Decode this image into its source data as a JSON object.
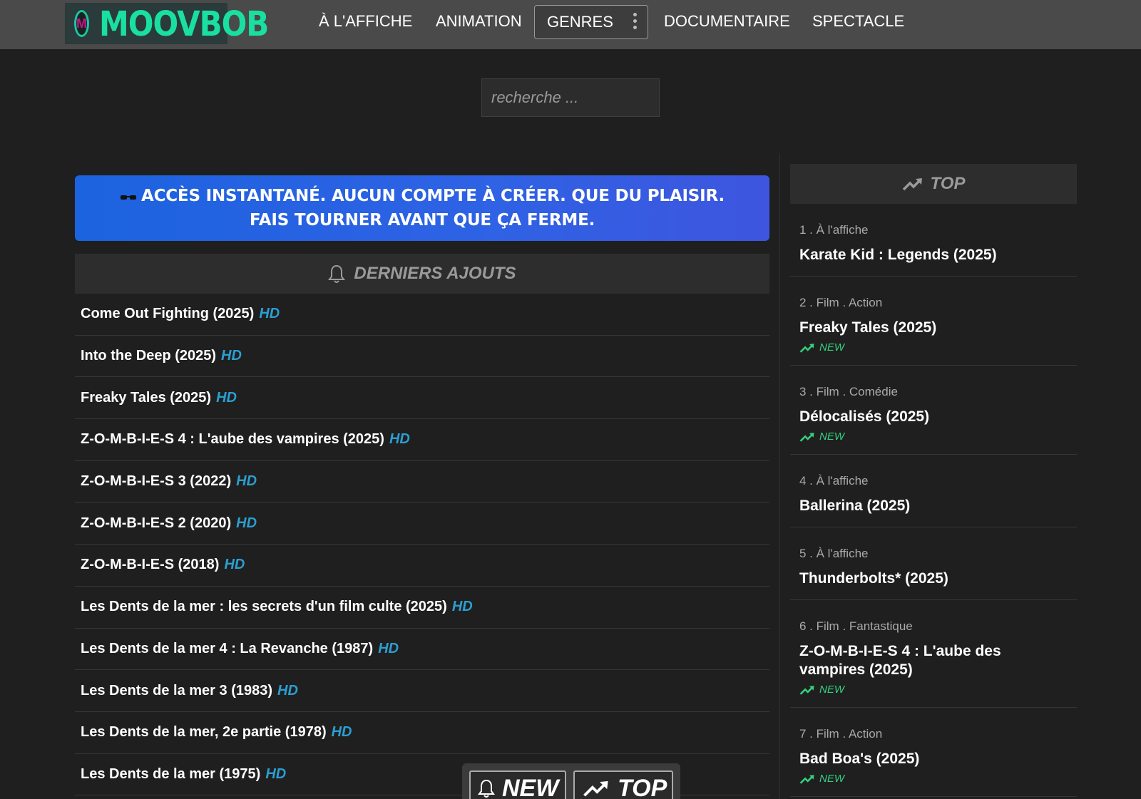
{
  "header": {
    "logo_letter": "M",
    "logo_text": "MOOVBOB",
    "nav": [
      "À L'AFFICHE",
      "ANIMATION",
      "GENRES",
      "DOCUMENTAIRE",
      "SPECTACLE"
    ]
  },
  "search": {
    "placeholder": "recherche ..."
  },
  "banner": {
    "text": "ACCÈS INSTANTANÉ. AUCUN COMPTE À CRÉER. QUE DU PLAISIR. FAIS TOURNER AVANT QUE ÇA FERME."
  },
  "latest": {
    "title": "DERNIERS AJOUTS",
    "hd_label": "HD",
    "items": [
      "Come Out Fighting (2025)",
      "Into the Deep (2025)",
      "Freaky Tales (2025)",
      "Z-O-M-B-I-E-S 4 : L'aube des vampires (2025)",
      "Z-O-M-B-I-E-S 3 (2022)",
      "Z-O-M-B-I-E-S 2 (2020)",
      "Z-O-M-B-I-E-S (2018)",
      "Les Dents de la mer : les secrets d'un film culte (2025)",
      "Les Dents de la mer 4 : La Revanche (1987)",
      "Les Dents de la mer 3 (1983)",
      "Les Dents de la mer, 2e partie (1978)",
      "Les Dents de la mer (1975)"
    ]
  },
  "top": {
    "title": "TOP",
    "new_label": "NEW",
    "items": [
      {
        "meta": "1 . À l'affiche",
        "title": "Karate Kid : Legends (2025)",
        "new": false
      },
      {
        "meta": "2 . Film . Action",
        "title": "Freaky Tales (2025)",
        "new": true
      },
      {
        "meta": "3 . Film . Comédie",
        "title": "Délocalisés (2025)",
        "new": true
      },
      {
        "meta": "4 . À l'affiche",
        "title": "Ballerina (2025)",
        "new": false
      },
      {
        "meta": "5 . À l'affiche",
        "title": "Thunderbolts* (2025)",
        "new": false
      },
      {
        "meta": "6 . Film . Fantastique",
        "title": "Z-O-M-B-I-E-S 4 : L'aube des vampires (2025)",
        "new": true
      },
      {
        "meta": "7 . Film . Action",
        "title": "Bad Boa's (2025)",
        "new": true
      }
    ]
  },
  "floating": {
    "new_label": "NEW",
    "top_label": "TOP"
  },
  "colors": {
    "accent": "#19e0a0",
    "hd": "#2b9fd1",
    "new": "#35d07f",
    "banner": "#2f62e4"
  }
}
